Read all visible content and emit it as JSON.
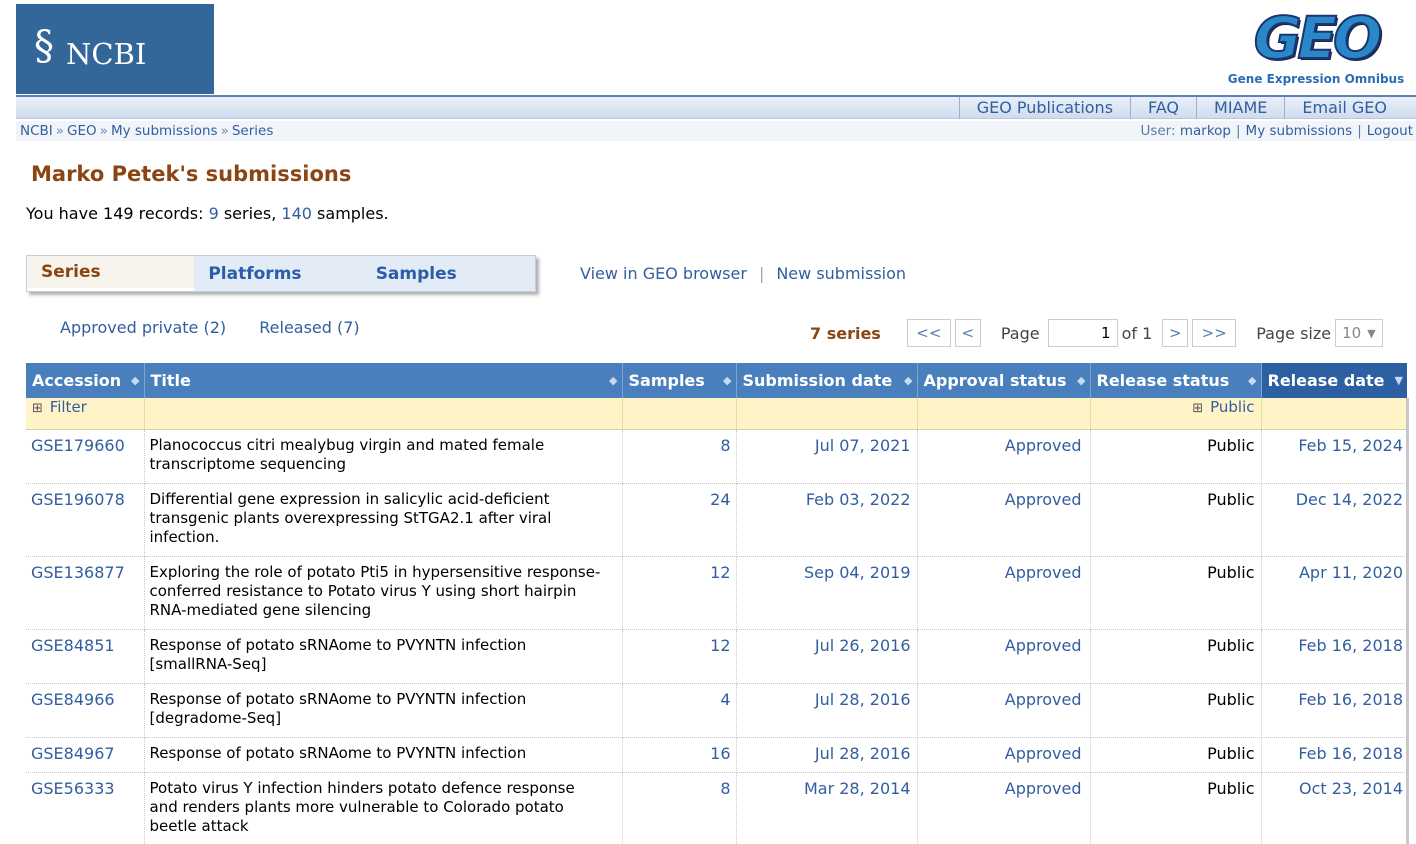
{
  "header": {
    "ncbi_logo_text": "NCBI",
    "geo_logo_text": "GEO",
    "geo_subtitle": "Gene Expression Omnibus",
    "nav": [
      "GEO Publications",
      "FAQ",
      "MIAME",
      "Email GEO"
    ]
  },
  "breadcrumb": [
    "NCBI",
    "GEO",
    "My submissions",
    "Series"
  ],
  "user": {
    "label": "User:",
    "name": "markop",
    "my_submissions": "My submissions",
    "logout": "Logout"
  },
  "page": {
    "title": "Marko Petek's submissions",
    "records_prefix": "You have 149 records:",
    "series_count": "9",
    "series_word": "series,",
    "samples_count": "140",
    "samples_word": "samples."
  },
  "tabs": [
    "Series",
    "Platforms",
    "Samples"
  ],
  "tab_links": [
    "View in GEO browser",
    "New submission"
  ],
  "filters": [
    "Approved private (2)",
    "Released (7)"
  ],
  "pager": {
    "count_label": "7 series",
    "first": "<<",
    "prev": "<",
    "page_label": "Page",
    "page_value": "1",
    "of_label": "of 1",
    "next": ">",
    "last": ">>",
    "page_size_label": "Page size",
    "page_size_value": "10"
  },
  "table": {
    "columns": [
      "Accession",
      "Title",
      "Samples",
      "Submission date",
      "Approval status",
      "Release status",
      "Release date"
    ],
    "filter_label": "Filter",
    "release_filter": "Public",
    "rows": [
      {
        "accession": "GSE179660",
        "title": "Planococcus citri mealybug virgin and mated female transcriptome sequencing",
        "samples": "8",
        "submitted": "Jul 07, 2021",
        "approval": "Approved",
        "release": "Public",
        "release_date": "Feb 15, 2024"
      },
      {
        "accession": "GSE196078",
        "title": "Differential gene expression in salicylic acid-deficient transgenic plants overexpressing StTGA2.1 after viral infection.",
        "samples": "24",
        "submitted": "Feb 03, 2022",
        "approval": "Approved",
        "release": "Public",
        "release_date": "Dec 14, 2022"
      },
      {
        "accession": "GSE136877",
        "title": "Exploring the role of potato Pti5 in hypersensitive response-conferred resistance to Potato virus Y using short hairpin RNA-mediated gene silencing",
        "samples": "12",
        "submitted": "Sep 04, 2019",
        "approval": "Approved",
        "release": "Public",
        "release_date": "Apr 11, 2020"
      },
      {
        "accession": "GSE84851",
        "title": "Response of potato sRNAome to PVYNTN infection [smallRNA-Seq]",
        "samples": "12",
        "submitted": "Jul 26, 2016",
        "approval": "Approved",
        "release": "Public",
        "release_date": "Feb 16, 2018"
      },
      {
        "accession": "GSE84966",
        "title": "Response of potato sRNAome to PVYNTN infection [degradome-Seq]",
        "samples": "4",
        "submitted": "Jul 28, 2016",
        "approval": "Approved",
        "release": "Public",
        "release_date": "Feb 16, 2018"
      },
      {
        "accession": "GSE84967",
        "title": "Response of potato sRNAome to PVYNTN infection",
        "samples": "16",
        "submitted": "Jul 28, 2016",
        "approval": "Approved",
        "release": "Public",
        "release_date": "Feb 16, 2018"
      },
      {
        "accession": "GSE56333",
        "title": "Potato virus Y infection hinders potato defence response and renders plants more vulnerable to Colorado potato beetle attack",
        "samples": "8",
        "submitted": "Mar 28, 2014",
        "approval": "Approved",
        "release": "Public",
        "release_date": "Oct 23, 2014"
      }
    ]
  }
}
